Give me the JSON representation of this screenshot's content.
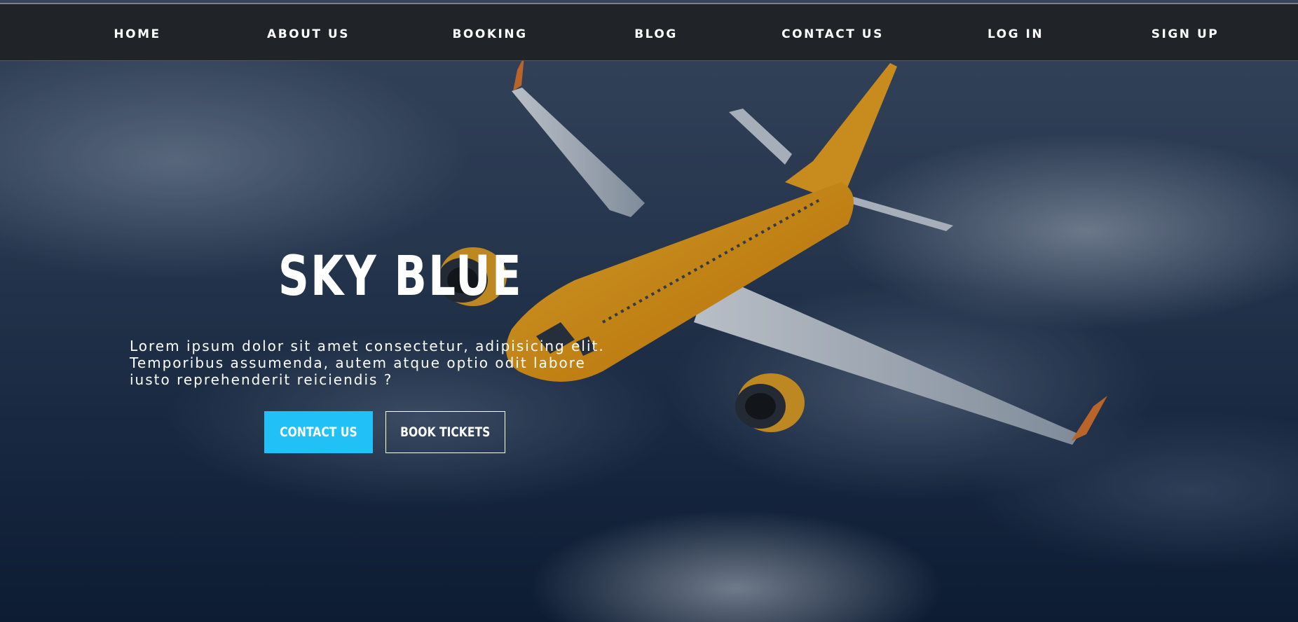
{
  "nav": {
    "items": [
      {
        "label": "HOME"
      },
      {
        "label": "ABOUT US"
      },
      {
        "label": "BOOKING"
      },
      {
        "label": "BLOG"
      },
      {
        "label": "CONTACT US"
      },
      {
        "label": "LOG IN"
      },
      {
        "label": "SIGN UP"
      }
    ]
  },
  "hero": {
    "title": "SKY BLUE",
    "description": "Lorem ipsum dolor sit amet consectetur, adipisicing elit. Temporibus assumenda, autem atque optio odit labore iusto reprehenderit reiciendis ?",
    "primary_button": "CONTACT US",
    "secondary_button": "BOOK TICKETS"
  },
  "colors": {
    "accent": "#21c1f7",
    "nav_background": "#1e2022",
    "plane_body": "#f0a419"
  }
}
